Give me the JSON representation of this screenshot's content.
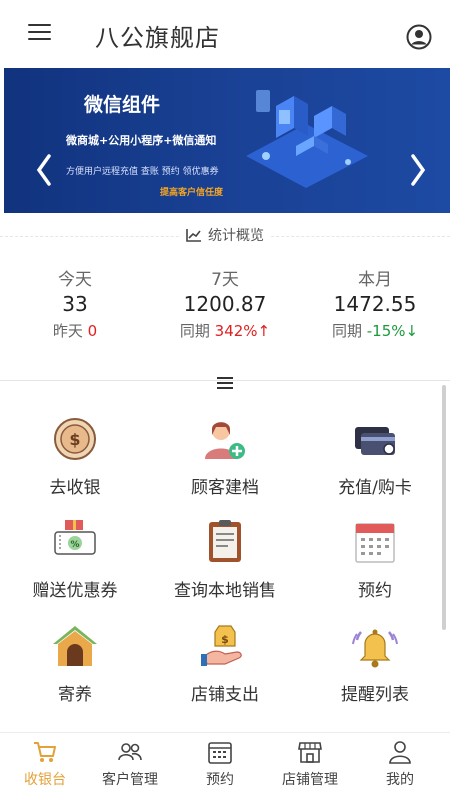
{
  "header": {
    "title": "八公旗舰店",
    "menu_icon": "hamburger-icon",
    "profile_icon": "user-circle-icon"
  },
  "banner": {
    "title": "微信组件",
    "subtitle": "微商城+公用小程序+微信通知",
    "description": "方便用户远程充值 查账 预约 领优惠券",
    "highlight": "提高客户信任度",
    "highlight_color": "#f5a623"
  },
  "stats": {
    "section_title": "统计概览",
    "items": [
      {
        "label": "今天",
        "value": "33",
        "compare_label": "昨天",
        "compare_value": "0"
      },
      {
        "label": "7天",
        "value": "1200.87",
        "compare_label": "同期",
        "compare_value": "342%↑"
      },
      {
        "label": "本月",
        "value": "1472.55",
        "compare_label": "同期",
        "compare_value": "-15%↓"
      }
    ]
  },
  "features": [
    {
      "label": "去收银",
      "icon": "coin-icon"
    },
    {
      "label": "顾客建档",
      "icon": "add-customer-icon"
    },
    {
      "label": "充值/购卡",
      "icon": "card-icon"
    },
    {
      "label": "赠送优惠券",
      "icon": "coupon-gift-icon"
    },
    {
      "label": "查询本地销售",
      "icon": "clipboard-icon"
    },
    {
      "label": "预约",
      "icon": "calendar-icon"
    },
    {
      "label": "寄养",
      "icon": "pet-house-icon"
    },
    {
      "label": "店铺支出",
      "icon": "hand-money-icon"
    },
    {
      "label": "提醒列表",
      "icon": "bell-icon"
    }
  ],
  "tabbar": [
    {
      "label": "收银台",
      "icon": "cart-icon",
      "active": true
    },
    {
      "label": "客户管理",
      "icon": "users-icon",
      "active": false
    },
    {
      "label": "预约",
      "icon": "calendar-icon",
      "active": false
    },
    {
      "label": "店铺管理",
      "icon": "store-icon",
      "active": false
    },
    {
      "label": "我的",
      "icon": "user-icon",
      "active": false
    }
  ],
  "colors": {
    "accent": "#e3a13a",
    "banner_blue": "#1a4296",
    "up_red": "#e02020",
    "down_green": "#1b9a3c"
  }
}
